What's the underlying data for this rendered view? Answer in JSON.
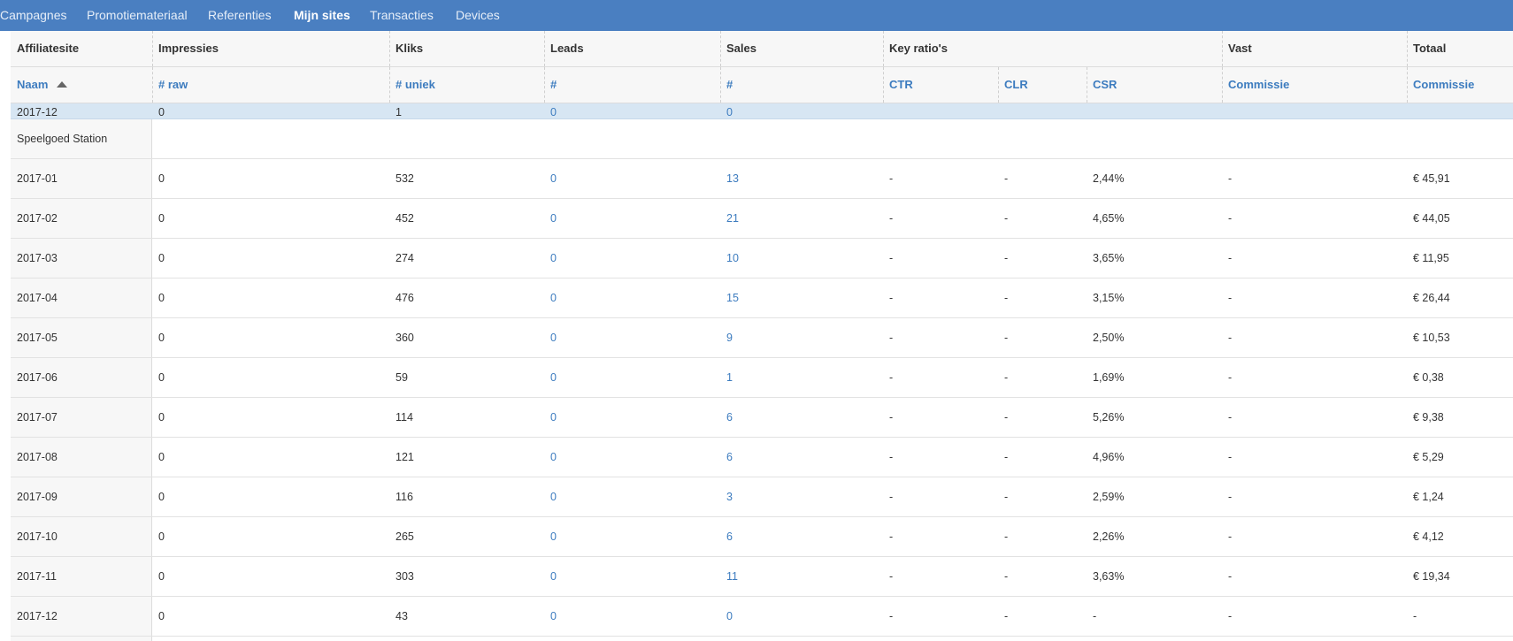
{
  "nav": {
    "items": [
      {
        "label": "Campagnes",
        "active": false
      },
      {
        "label": "Promotiemateriaal",
        "active": false
      },
      {
        "label": "Referenties",
        "active": false
      },
      {
        "label": "Mijn sites",
        "active": true
      },
      {
        "label": "Transacties",
        "active": false
      },
      {
        "label": "Devices",
        "active": false
      }
    ]
  },
  "table": {
    "group_headers": [
      "Affiliatesite",
      "Impressies",
      "Kliks",
      "Leads",
      "Sales",
      "Key ratio's",
      "Vast",
      "Totaal"
    ],
    "sub_headers": [
      "Naam",
      "# raw",
      "# uniek",
      "#",
      "#",
      "CTR",
      "CLR",
      "CSR",
      "Commissie",
      "Commissie"
    ],
    "sort_column": "Naam",
    "sort_direction": "ascending",
    "partial_row": [
      "2017-12",
      "0",
      "1",
      "0",
      "0"
    ],
    "group_label": "Speelgoed Station",
    "rows": [
      [
        "2017-01",
        "0",
        "532",
        "0",
        "13",
        "-",
        "-",
        "2,44%",
        "-",
        "€ 45,91"
      ],
      [
        "2017-02",
        "0",
        "452",
        "0",
        "21",
        "-",
        "-",
        "4,65%",
        "-",
        "€ 44,05"
      ],
      [
        "2017-03",
        "0",
        "274",
        "0",
        "10",
        "-",
        "-",
        "3,65%",
        "-",
        "€ 11,95"
      ],
      [
        "2017-04",
        "0",
        "476",
        "0",
        "15",
        "-",
        "-",
        "3,15%",
        "-",
        "€ 26,44"
      ],
      [
        "2017-05",
        "0",
        "360",
        "0",
        "9",
        "-",
        "-",
        "2,50%",
        "-",
        "€ 10,53"
      ],
      [
        "2017-06",
        "0",
        "59",
        "0",
        "1",
        "-",
        "-",
        "1,69%",
        "-",
        "€ 0,38"
      ],
      [
        "2017-07",
        "0",
        "114",
        "0",
        "6",
        "-",
        "-",
        "5,26%",
        "-",
        "€ 9,38"
      ],
      [
        "2017-08",
        "0",
        "121",
        "0",
        "6",
        "-",
        "-",
        "4,96%",
        "-",
        "€ 5,29"
      ],
      [
        "2017-09",
        "0",
        "116",
        "0",
        "3",
        "-",
        "-",
        "2,59%",
        "-",
        "€ 1,24"
      ],
      [
        "2017-10",
        "0",
        "265",
        "0",
        "6",
        "-",
        "-",
        "2,26%",
        "-",
        "€ 4,12"
      ],
      [
        "2017-11",
        "0",
        "303",
        "0",
        "11",
        "-",
        "-",
        "3,63%",
        "-",
        "€ 19,34"
      ],
      [
        "2017-12",
        "0",
        "43",
        "0",
        "0",
        "-",
        "-",
        "-",
        "-",
        "-"
      ]
    ]
  },
  "colors": {
    "nav_bg": "#4a7fc1",
    "link_blue": "#3d7cbf",
    "highlight_row": "#d7e6f3",
    "header_bg": "#f7f7f7"
  }
}
